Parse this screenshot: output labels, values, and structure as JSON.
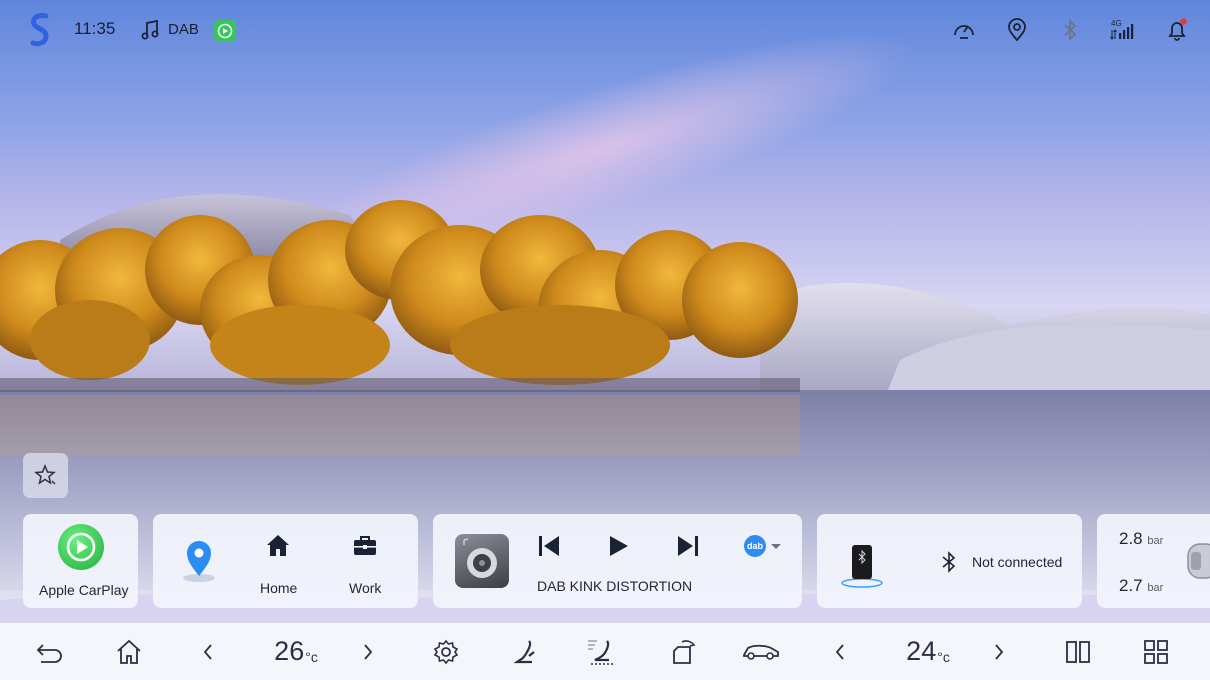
{
  "status_bar": {
    "time": "11:35",
    "source_label": "DAB",
    "icons": [
      "s-logo-icon",
      "music-note-icon",
      "carplay-icon",
      "speedometer-icon",
      "location-pin-icon",
      "bluetooth-icon",
      "signal-4g-icon",
      "notification-bell-icon"
    ],
    "signal_label": "4G"
  },
  "cards": {
    "carplay": {
      "label": "Apple CarPlay"
    },
    "navigation": {
      "home_label": "Home",
      "work_label": "Work"
    },
    "media": {
      "station": "DAB KINK DISTORTION",
      "source_badge": "dab"
    },
    "bluetooth": {
      "status": "Not connected"
    },
    "tire_pressure": {
      "front_value": "2.8",
      "rear_value": "2.7",
      "unit": "bar"
    }
  },
  "bottom_bar": {
    "left_temp": "26",
    "right_temp": "24",
    "temp_unit": "°c"
  },
  "colors": {
    "carplay_green": "#35c75a",
    "dab_blue": "#2f8cf0",
    "nav_pin_blue": "#2a8df2",
    "notification_red": "#e53935"
  }
}
